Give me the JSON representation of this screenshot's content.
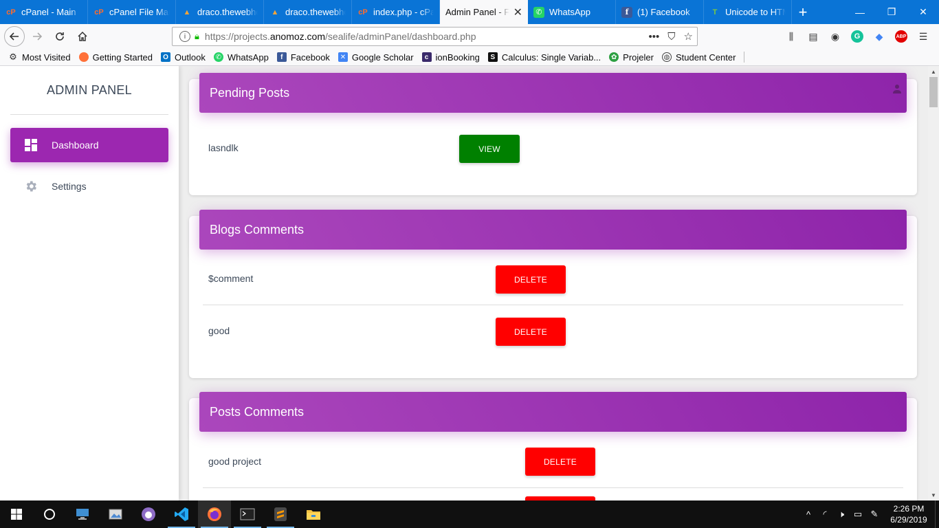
{
  "browser": {
    "tabs": [
      {
        "label": "cPanel - Main",
        "icon": "cpanel-icon",
        "active": false
      },
      {
        "label": "cPanel File Mana",
        "icon": "cpanel-icon",
        "active": false
      },
      {
        "label": "draco.thewebho",
        "icon": "draco-icon",
        "active": false
      },
      {
        "label": "draco.thewebho",
        "icon": "draco-icon",
        "active": false
      },
      {
        "label": "index.php - cPa",
        "icon": "cpanel-icon",
        "active": false
      },
      {
        "label": "Admin Panel - Fi",
        "icon": "",
        "active": true
      },
      {
        "label": "WhatsApp",
        "icon": "whatsapp-icon",
        "active": false
      },
      {
        "label": "(1) Facebook",
        "icon": "facebook-icon",
        "active": false
      },
      {
        "label": "Unicode to HTM",
        "icon": "unicode-icon",
        "active": false
      }
    ],
    "url": {
      "prefix": "https://projects.",
      "domain": "anomoz.com",
      "path": "/sealife/adminPanel/dashboard.php"
    },
    "bookmarks": [
      {
        "label": "Most Visited",
        "icon": "gear-icon"
      },
      {
        "label": "Getting Started",
        "icon": "firefox-icon"
      },
      {
        "label": "Outlook",
        "icon": "outlook-icon"
      },
      {
        "label": "WhatsApp",
        "icon": "whatsapp-icon"
      },
      {
        "label": "Facebook",
        "icon": "facebook-icon"
      },
      {
        "label": "Google Scholar",
        "icon": "scholar-icon"
      },
      {
        "label": "ionBooking",
        "icon": "ionbooking-icon"
      },
      {
        "label": "Calculus: Single Variab...",
        "icon": "calculus-icon"
      },
      {
        "label": "Projeler",
        "icon": "projeler-icon"
      },
      {
        "label": "Student Center",
        "icon": "globe-icon"
      }
    ]
  },
  "sidebar": {
    "brand": "ADMIN PANEL",
    "items": [
      {
        "label": "Dashboard",
        "icon": "dashboard-icon",
        "active": true
      },
      {
        "label": "Settings",
        "icon": "gear-icon",
        "active": false
      }
    ]
  },
  "cards": {
    "pending_posts": {
      "title": "Pending Posts",
      "rows": [
        {
          "text": "lasndlk",
          "button": "VIEW"
        }
      ]
    },
    "blogs_comments": {
      "title": "Blogs Comments",
      "rows": [
        {
          "text": "$comment",
          "button": "DELETE"
        },
        {
          "text": "good",
          "button": "DELETE"
        }
      ]
    },
    "posts_comments": {
      "title": "Posts Comments",
      "rows": [
        {
          "text": "good project",
          "button": "DELETE"
        }
      ]
    }
  },
  "colors": {
    "accent": "#9c27b0",
    "view_button": "#008000",
    "delete_button": "#ff0000",
    "tab_bar": "#0a74d6"
  },
  "taskbar": {
    "clock_time": "2:26 PM",
    "clock_date": "6/29/2019"
  }
}
